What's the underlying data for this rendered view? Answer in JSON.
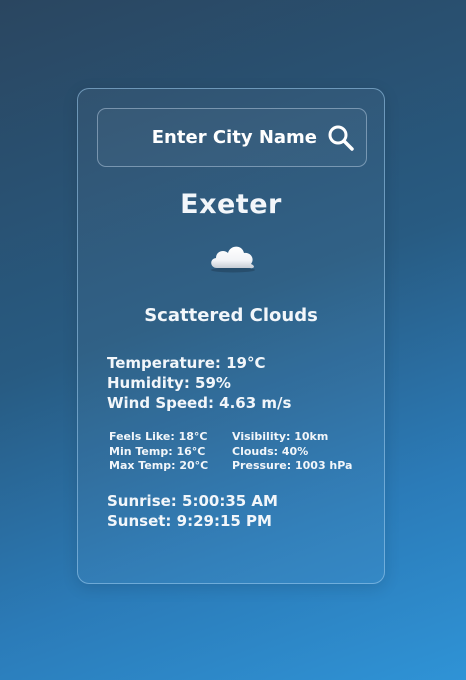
{
  "search": {
    "placeholder": "Enter City Name",
    "icon": "search-icon"
  },
  "weather": {
    "city": "Exeter",
    "icon": "cloud-icon",
    "description": "Scattered Clouds",
    "temperature": "Temperature: 19°C",
    "humidity": "Humidity: 59%",
    "wind_speed": "Wind Speed: 4.63 m/s"
  },
  "details": {
    "feels_like": "Feels Like: 18°C",
    "min_temp": "Min Temp: 16°C",
    "max_temp": "Max Temp: 20°C",
    "visibility": "Visibility: 10km",
    "clouds": "Clouds: 40%",
    "pressure": "Pressure: 1003 hPa"
  },
  "sun": {
    "sunrise": "Sunrise: 5:00:35 AM",
    "sunset": "Sunset: 9:29:15 PM"
  },
  "colors": {
    "background_top": "#2a4660",
    "background_bottom": "#2f93d6",
    "text": "#f2f6fa",
    "card_border": "#a0cdf0"
  }
}
